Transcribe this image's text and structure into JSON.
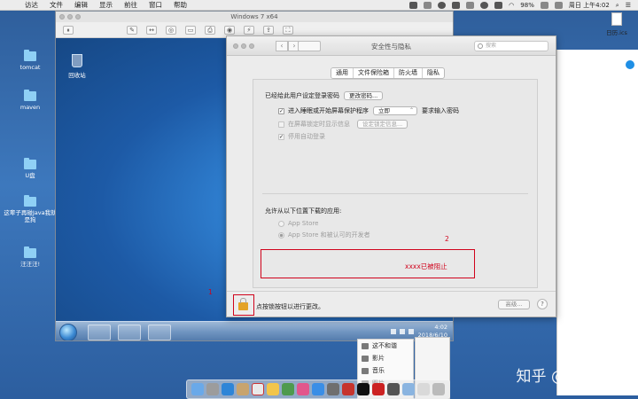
{
  "menubar": {
    "items": [
      "访达",
      "文件",
      "编辑",
      "显示",
      "前往",
      "窗口",
      "帮助"
    ],
    "battery": "98%",
    "clock": "周日 上午4:02"
  },
  "desktop": {
    "icons": [
      "tomcat",
      "maven",
      "U盘",
      "这辈子再碰Java我就是狗",
      "汪汪汪!"
    ],
    "file_icon": "日历.ics"
  },
  "vm": {
    "title": "Windows 7 x64",
    "recycle_bin": "回收站",
    "clock_time": "4:02",
    "clock_date": "2018/6/10"
  },
  "prefs": {
    "title": "安全性与隐私",
    "search_placeholder": "搜索",
    "tabs": [
      "通用",
      "文件保险箱",
      "防火墙",
      "隐私"
    ],
    "login_pw_label": "已经给此用户设定登录密码",
    "change_pw_button": "更改密码...",
    "require_pw_pre": "进入睡眠或开始屏幕保护程序",
    "require_pw_select": "立即",
    "require_pw_post": "要求输入密码",
    "show_message_label": "在屏幕锁定时显示信息",
    "set_lock_message_button": "设定锁定信息...",
    "disable_autologin_label": "停用自动登录",
    "allow_apps_label": "允许从以下位置下载的应用:",
    "radio_app_store": "App Store",
    "radio_app_store_dev": "App Store 和被认可的开发者",
    "blocked_message": "xxxx已被阻止",
    "lock_text": "点按锁按钮以进行更改。",
    "advanced_button": "高级...",
    "help_button": "?"
  },
  "annotations": {
    "label_1": "1",
    "label_2": "2"
  },
  "finder": {
    "items": [
      "这不和谐",
      "影片",
      "音乐",
      "图片"
    ]
  },
  "watermark": "知乎 @Emmos"
}
